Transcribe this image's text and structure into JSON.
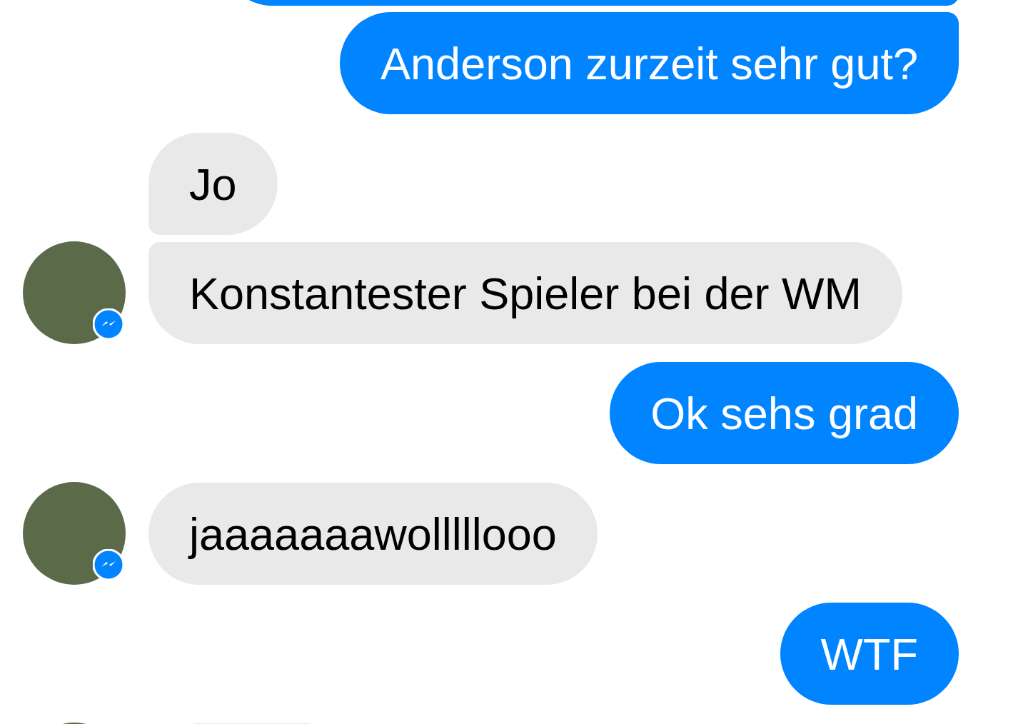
{
  "messages": [
    {
      "kind": "sent"
    },
    {
      "kind": "sent",
      "text": "Anderson zurzeit sehr gut?"
    },
    {
      "kind": "received",
      "avatar": false,
      "text": "Jo"
    },
    {
      "kind": "received",
      "avatar": true,
      "text": "Konstantester Spieler bei der WM"
    },
    {
      "kind": "sent",
      "text": "Ok sehs grad"
    },
    {
      "kind": "received",
      "avatar": true,
      "text": "jaaaaaaawolllllooo"
    },
    {
      "kind": "sent",
      "text": "WTF"
    },
    {
      "kind": "received",
      "avatar": true
    }
  ]
}
